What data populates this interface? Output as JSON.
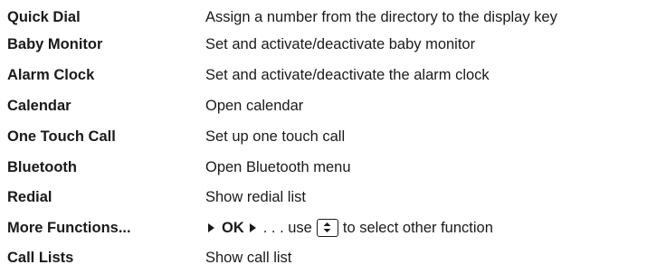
{
  "rows": [
    {
      "term": "Quick Dial",
      "desc": "Assign a number from the directory to the display key"
    },
    {
      "term": "Baby Monitor",
      "desc": "Set and activate/deactivate baby monitor"
    },
    {
      "term": "Alarm Clock",
      "desc": "Set and activate/deactivate the alarm clock"
    },
    {
      "term": "Calendar",
      "desc": "Open calendar"
    },
    {
      "term": "One Touch Call",
      "desc": "Set up one touch call"
    },
    {
      "term": "Bluetooth",
      "desc": "Open Bluetooth menu"
    },
    {
      "term": "Redial",
      "desc": "Show redial list"
    },
    {
      "term": "More Functions...",
      "desc_parts": {
        "ok": "OK",
        "use": ". . . use",
        "rest": "to select other function"
      }
    },
    {
      "term": "Call Lists",
      "desc": "Show call list"
    }
  ],
  "icons": {
    "arrow": "arrow-right-icon",
    "nav_key": "nav-key-up-down-icon"
  }
}
